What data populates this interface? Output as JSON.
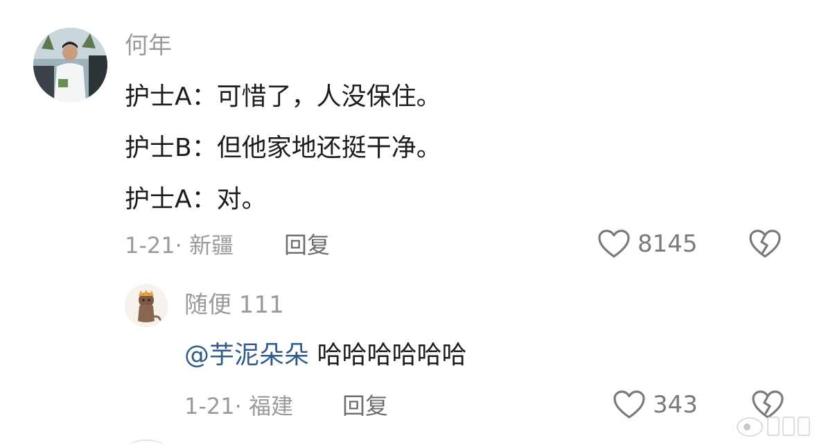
{
  "comment": {
    "author": "何年",
    "lines": [
      "护士A：可惜了，人没保住。",
      "护士B：但他家地还挺干净。",
      "护士A：对。"
    ],
    "meta": "1-21· 新疆",
    "reply_label": "回复",
    "likes": "8145"
  },
  "reply": {
    "author": "随便 111",
    "mention": "@芋泥朵朵",
    "text": "哈哈哈哈哈哈",
    "meta": "1-21· 福建",
    "reply_label": "回复",
    "likes": "343"
  },
  "icons": {
    "like": "heart-outline-icon",
    "dislike": "broken-heart-icon"
  },
  "colors": {
    "mention": "#2f5a8c",
    "text": "#1c1c1c",
    "muted": "#9a9a9a"
  }
}
